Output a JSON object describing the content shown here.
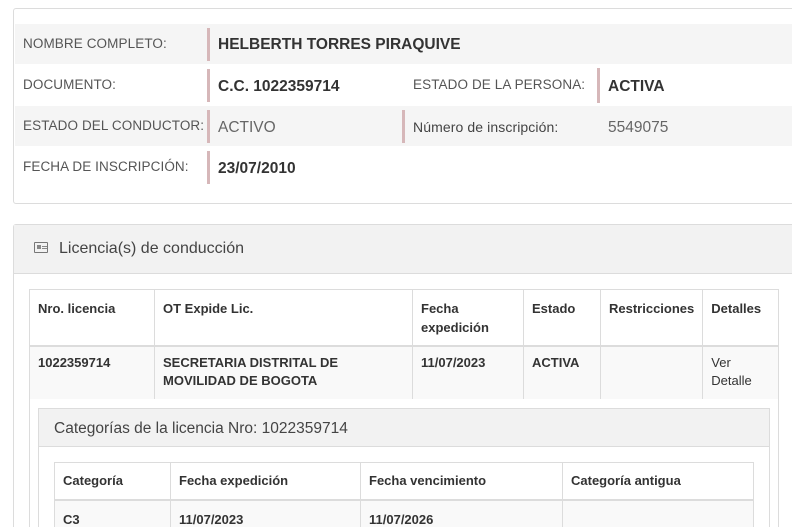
{
  "person": {
    "nombre_label": "NOMBRE COMPLETO:",
    "nombre_value": "HELBERTH TORRES PIRAQUIVE",
    "documento_label": "DOCUMENTO:",
    "documento_value": "C.C. 1022359714",
    "estado_persona_label": "ESTADO DE LA PERSONA:",
    "estado_persona_value": "ACTIVA",
    "estado_conductor_label": "ESTADO DEL CONDUCTOR:",
    "estado_conductor_value": "ACTIVO",
    "inscripcion_num_label": "Número de inscripción:",
    "inscripcion_num_value": "5549075",
    "fecha_inscripcion_label": "FECHA DE INSCRIPCIÓN:",
    "fecha_inscripcion_value": "23/07/2010"
  },
  "licencias": {
    "title": "Licencia(s) de conducción",
    "icon": "id-card-icon",
    "headers": [
      "Nro. licencia",
      "OT Expide Lic.",
      "Fecha expedición",
      "Estado",
      "Restricciones",
      "Detalles"
    ],
    "rows": [
      {
        "nro": "1022359714",
        "ot": "SECRETARIA DISTRITAL DE MOVILIDAD DE BOGOTA",
        "fecha": "11/07/2023",
        "estado": "ACTIVA",
        "restricciones": "",
        "detalles": "Ver Detalle"
      }
    ]
  },
  "categorias": {
    "title": "Categorías de la licencia Nro: 1022359714",
    "headers": [
      "Categoría",
      "Fecha expedición",
      "Fecha vencimiento",
      "Categoría antigua"
    ],
    "rows": [
      {
        "categoria": "C3",
        "expedicion": "11/07/2023",
        "vencimiento": "11/07/2026",
        "antigua": ""
      }
    ]
  },
  "colors": {
    "accent_bar": "#d6b7b9",
    "panel_header_bg": "#f2f2f2",
    "border": "#dcdcdc"
  }
}
